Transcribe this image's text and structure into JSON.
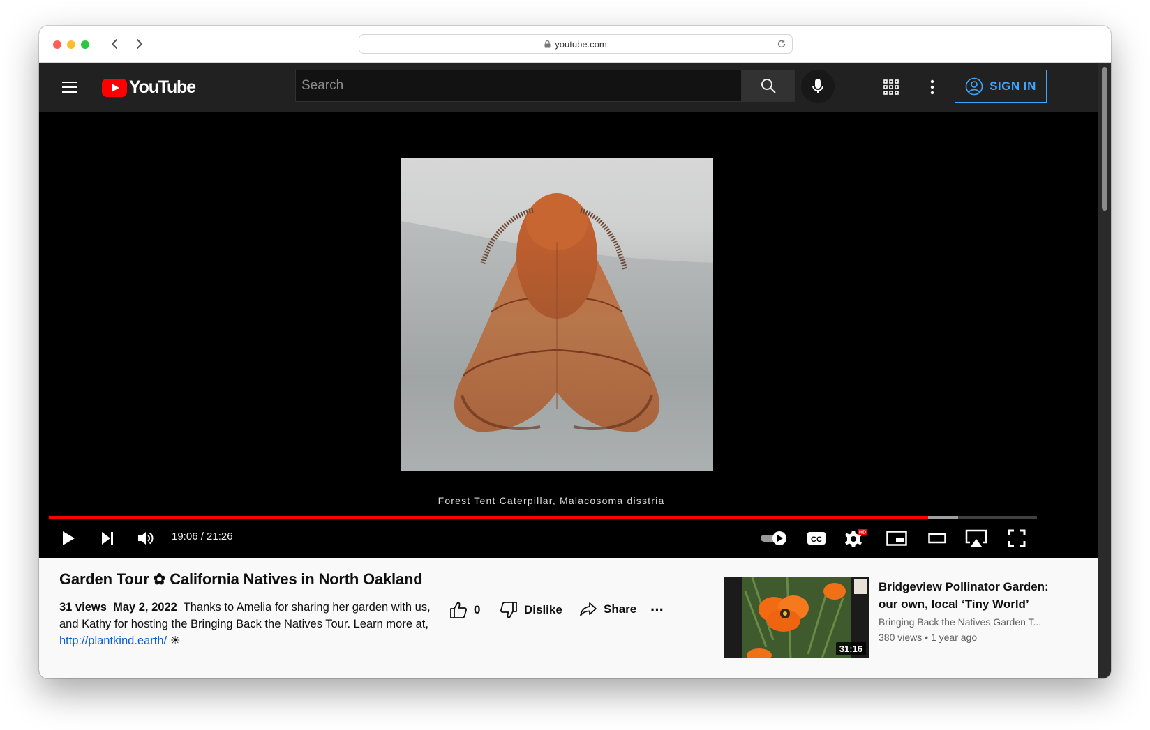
{
  "browser": {
    "url": "youtube.com"
  },
  "masthead": {
    "logo_text": "YouTube",
    "search_placeholder": "Search",
    "signin_label": "SIGN IN"
  },
  "player": {
    "caption": "Forest Tent Caterpillar, Malacosoma disstria",
    "time_display": "19:06 / 21:26",
    "progress_played_fraction": 0.89,
    "progress_buffered_fraction": 0.92,
    "quality_badge": "HD",
    "cc_label": "CC"
  },
  "video": {
    "title": "Garden Tour ✿ California Natives in North Oakland",
    "views": "31 views",
    "date": "May 2, 2022",
    "description": "Thanks to Amelia for sharing her garden with us, and Kathy for hosting the Bringing Back the Natives Tour. Learn more at,",
    "link": "http://plantkind.earth/",
    "trailing_symbol": "☀"
  },
  "actions": {
    "like_count": "0",
    "dislike_label": "Dislike",
    "share_label": "Share",
    "more_label": "···"
  },
  "recommendation": {
    "title": "Bridgeview Pollinator Garden: our own, local ‘Tiny World’",
    "channel": "Bringing Back the Natives Garden T...",
    "views": "380 views",
    "age": "1 year ago",
    "separator": "•",
    "duration": "31:16"
  },
  "colors": {
    "brand_red": "#ff0000",
    "link_blue": "#065fd4",
    "signin_blue": "#3ea6ff"
  }
}
